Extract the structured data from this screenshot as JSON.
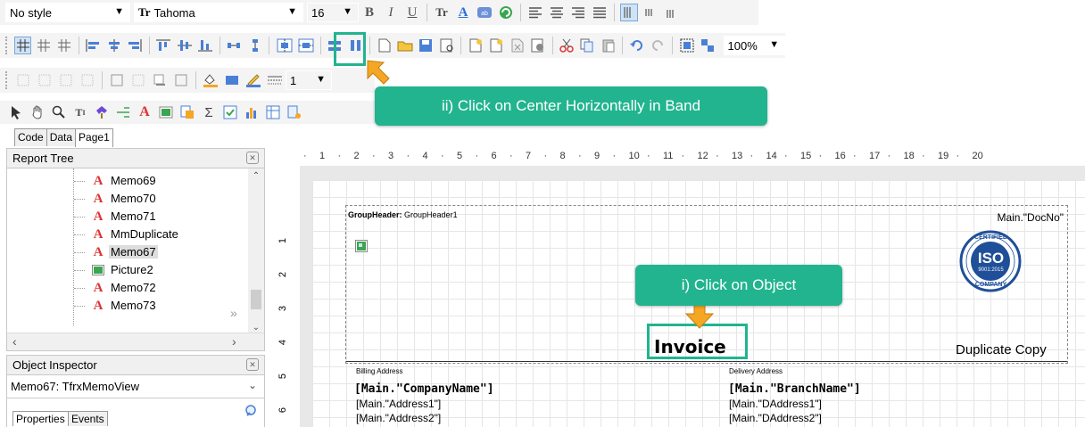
{
  "toolbar1": {
    "style_value": "No style",
    "font_value": "Tahoma",
    "size_value": "16"
  },
  "toolbar2": {
    "zoom_value": "100%"
  },
  "toolbar3": {
    "line_width_value": "1"
  },
  "tabs": [
    {
      "label": "Code"
    },
    {
      "label": "Data"
    },
    {
      "label": "Page1"
    }
  ],
  "report_tree": {
    "title": "Report Tree",
    "items": [
      {
        "label": "Memo69",
        "icon": "text-a-icon"
      },
      {
        "label": "Memo70",
        "icon": "text-a-icon"
      },
      {
        "label": "Memo71",
        "icon": "text-a-icon"
      },
      {
        "label": "MmDuplicate",
        "icon": "text-a-icon"
      },
      {
        "label": "Memo67",
        "icon": "text-a-icon"
      },
      {
        "label": "Picture2",
        "icon": "picture-icon"
      },
      {
        "label": "Memo72",
        "icon": "text-a-icon"
      },
      {
        "label": "Memo73",
        "icon": "text-a-icon"
      }
    ]
  },
  "object_inspector": {
    "title": "Object Inspector",
    "selected": "Memo67: TfrxMemoView",
    "tab_properties": "Properties",
    "tab_events": "Events"
  },
  "ruler": {
    "ticks": [
      "1",
      "2",
      "3",
      "4",
      "5",
      "6",
      "7",
      "8",
      "9",
      "10",
      "11",
      "12",
      "13",
      "14",
      "15",
      "16",
      "17",
      "18",
      "19",
      "20"
    ]
  },
  "vruler": {
    "ticks": [
      "1",
      "2",
      "3",
      "4",
      "5",
      "6"
    ]
  },
  "report": {
    "band_label": "GroupHeader:",
    "band_name": "GroupHeader1",
    "docno": "Main.\"DocNo\"",
    "title": "Invoice",
    "duplicate": "Duplicate Copy",
    "billing_label": "Billing Address",
    "delivery_label": "Delivery Address",
    "company": "[Main.\"CompanyName\"]",
    "branch": "[Main.\"BranchName\"]",
    "address1": "[Main.\"Address1\"]",
    "address2": "[Main.\"Address2\"]",
    "daddress1": "[Main.\"DAddress1\"]",
    "daddress2": "[Main.\"DAddress2\"]",
    "iso_text": "ISO",
    "iso_top": "CERTIFIED",
    "iso_num": "9001:2015",
    "iso_bottom": "COMPANY"
  },
  "callouts": {
    "step2": "ii) Click on Center Horizontally in Band",
    "step1": "i) Click on Object"
  },
  "colors": {
    "accent": "#21b48f",
    "arrow": "#f5a623"
  }
}
